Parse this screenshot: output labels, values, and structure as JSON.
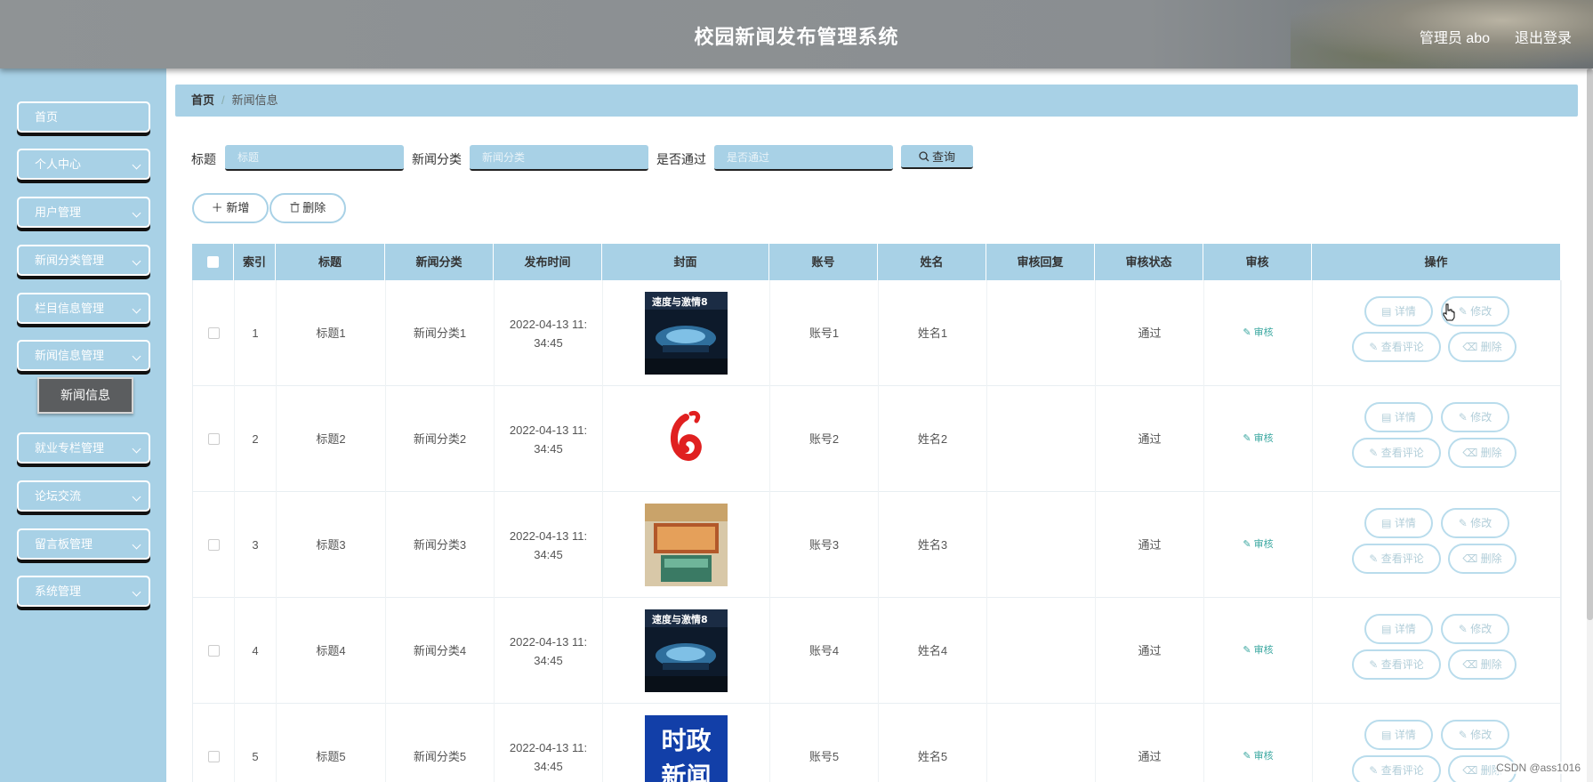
{
  "header": {
    "title": "校园新闻发布管理系统",
    "admin": "管理员 abo",
    "logout": "退出登录"
  },
  "sidebar": {
    "items": [
      {
        "label": "首页",
        "has_children": false
      },
      {
        "label": "个人中心",
        "has_children": true
      },
      {
        "label": "用户管理",
        "has_children": true
      },
      {
        "label": "新闻分类管理",
        "has_children": true
      },
      {
        "label": "栏目信息管理",
        "has_children": true
      },
      {
        "label": "新闻信息管理",
        "has_children": true
      },
      {
        "label": "就业专栏管理",
        "has_children": true
      },
      {
        "label": "论坛交流",
        "has_children": true
      },
      {
        "label": "留言板管理",
        "has_children": true
      },
      {
        "label": "系统管理",
        "has_children": true
      }
    ],
    "submenu_active": "新闻信息"
  },
  "breadcrumb": {
    "home": "首页",
    "current": "新闻信息"
  },
  "filters": {
    "title_label": "标题",
    "title_placeholder": "标题",
    "category_label": "新闻分类",
    "category_placeholder": "新闻分类",
    "passed_label": "是否通过",
    "passed_placeholder": "是否通过",
    "query_label": "查询"
  },
  "actions": {
    "add": "新增",
    "delete": "删除"
  },
  "table": {
    "headers": [
      "索引",
      "标题",
      "新闻分类",
      "发布时间",
      "封面",
      "账号",
      "姓名",
      "审核回复",
      "审核状态",
      "审核",
      "操作"
    ],
    "rows": [
      {
        "index": "1",
        "title": "标题1",
        "category": "新闻分类1",
        "time": "2022-04-13 11:34:45",
        "cover": "movie-poster",
        "account": "账号1",
        "name": "姓名1",
        "reply": "",
        "status": "通过",
        "audit": "审核"
      },
      {
        "index": "2",
        "title": "标题2",
        "category": "新闻分类2",
        "time": "2022-04-13 11:34:45",
        "cover": "red-logo",
        "account": "账号2",
        "name": "姓名2",
        "reply": "",
        "status": "通过",
        "audit": "审核"
      },
      {
        "index": "3",
        "title": "标题3",
        "category": "新闻分类3",
        "time": "2022-04-13 11:34:45",
        "cover": "shop-photo",
        "account": "账号3",
        "name": "姓名3",
        "reply": "",
        "status": "通过",
        "audit": "审核"
      },
      {
        "index": "4",
        "title": "标题4",
        "category": "新闻分类4",
        "time": "2022-04-13 11:34:45",
        "cover": "movie-poster",
        "account": "账号4",
        "name": "姓名4",
        "reply": "",
        "status": "通过",
        "audit": "审核"
      },
      {
        "index": "5",
        "title": "标题5",
        "category": "新闻分类5",
        "time": "2022-04-13 11:34:45",
        "cover": "politics-news",
        "account": "账号5",
        "name": "姓名5",
        "reply": "",
        "status": "通过",
        "audit": "审核"
      }
    ],
    "row_buttons": {
      "detail": "详情",
      "edit": "修改",
      "comments": "查看评论",
      "delete": "删除"
    },
    "time_line1": "2022-04-13 11:",
    "time_line2": "34:45"
  },
  "covers": {
    "movie_title": "速度与激情8",
    "politics_line1": "时政",
    "politics_line2": "新闻"
  },
  "watermark": "CSDN @ass1016",
  "colors": {
    "accent": "#a8d1e6",
    "header": "#8f9395",
    "active_submenu": "#5b5d5f",
    "audit_link": "#3aa7a0"
  }
}
